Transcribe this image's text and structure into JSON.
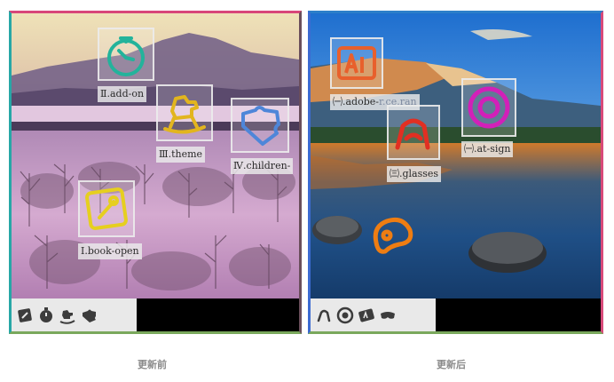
{
  "before": {
    "caption": "更新前",
    "labels": {
      "add_on": "Ⅱ.add-on",
      "theme": "Ⅲ.theme",
      "children": "Ⅳ.children-",
      "book_open": "Ⅰ.book-open"
    },
    "tray_icons": [
      "book-open",
      "stopwatch",
      "rocking-horse",
      "puzzle-piece"
    ],
    "colors": {
      "add_on": "#23b39b",
      "theme": "#e2b51e",
      "children": "#4e86d9",
      "book_open": "#e6cf1f"
    }
  },
  "after": {
    "caption": "更新后",
    "labels": {
      "adobe": "㈠.adobe-",
      "adobe_hidden": "r.ce.ran",
      "glasses": "㈢.glasses",
      "at_sign": "㈠.at-sign"
    },
    "tray_icons": [
      "glasses",
      "at-sign",
      "adobe",
      "goggles"
    ],
    "colors": {
      "adobe": "#e8602c",
      "glasses": "#e12f22",
      "at_sign": "#d220b8",
      "goggles": "#ee7d12"
    }
  }
}
